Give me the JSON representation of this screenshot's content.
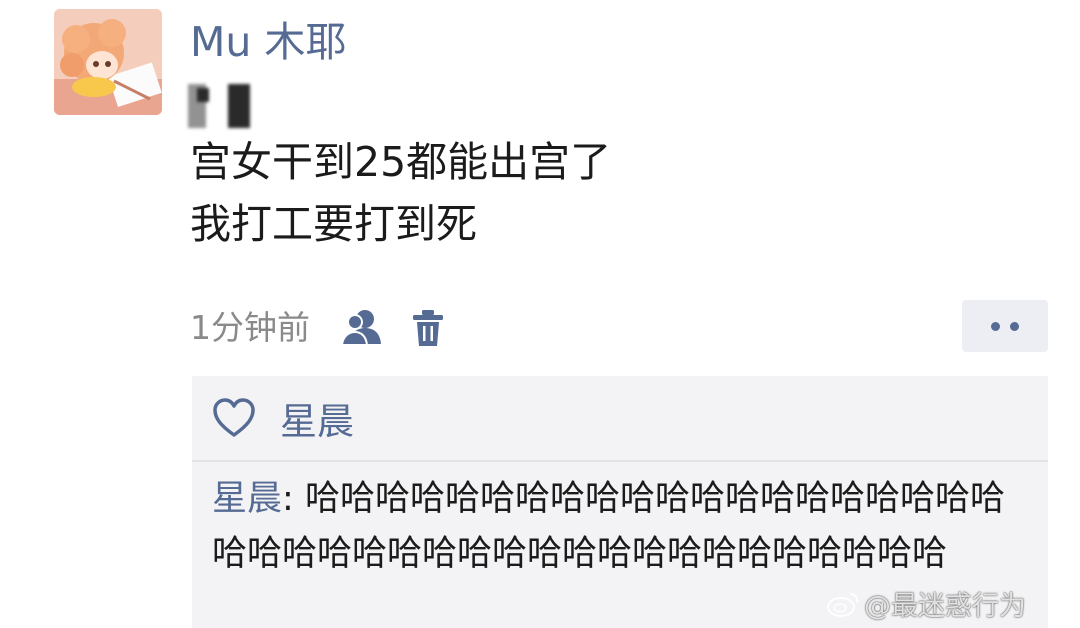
{
  "post": {
    "username": "Mu 木耶",
    "text_line1": "宫女干到25都能出宫了",
    "text_line2": "我打工要打到死",
    "timestamp": "1分钟前"
  },
  "likes": {
    "names": "星晨"
  },
  "comment": {
    "author": "星晨",
    "separator": ": ",
    "text": "哈哈哈哈哈哈哈哈哈哈哈哈哈哈哈哈哈哈哈哈哈哈哈哈哈哈哈哈哈哈哈哈哈哈哈哈哈哈哈哈哈"
  },
  "watermark": {
    "text": "@最迷惑行为"
  },
  "colors": {
    "link": "#566b94",
    "text": "#1b1b1b",
    "muted": "#8a8a8a",
    "comment_bg": "#f3f3f5"
  },
  "icons": [
    "friends-visibility-icon",
    "trash-icon",
    "more-dots-icon",
    "heart-outline-icon",
    "weibo-logo-icon"
  ]
}
